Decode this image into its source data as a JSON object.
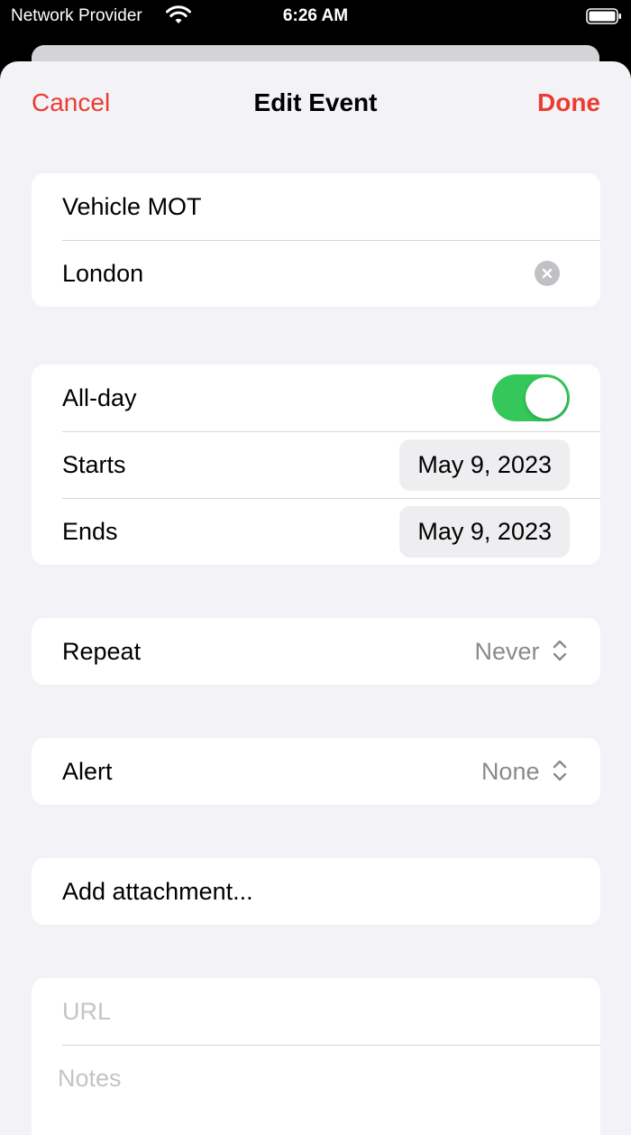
{
  "status_bar": {
    "carrier": "Network Provider",
    "time": "6:26 AM",
    "icons": [
      "wifi-icon",
      "battery-icon"
    ]
  },
  "nav": {
    "cancel_label": "Cancel",
    "title": "Edit Event",
    "done_label": "Done"
  },
  "event": {
    "title_value": "Vehicle MOT",
    "location_value": "London"
  },
  "schedule": {
    "all_day_label": "All-day",
    "all_day_on": true,
    "starts_label": "Starts",
    "starts_value": "May 9, 2023",
    "ends_label": "Ends",
    "ends_value": "May 9, 2023"
  },
  "repeat": {
    "label": "Repeat",
    "value": "Never"
  },
  "alert": {
    "label": "Alert",
    "value": "None"
  },
  "attachment": {
    "label": "Add attachment..."
  },
  "extras": {
    "url_placeholder": "URL",
    "notes_placeholder": "Notes"
  },
  "colors": {
    "accent": "#ec3b30",
    "toggle_on": "#34c759",
    "background": "#f2f2f7",
    "secondary_text": "#8a8a8e"
  }
}
